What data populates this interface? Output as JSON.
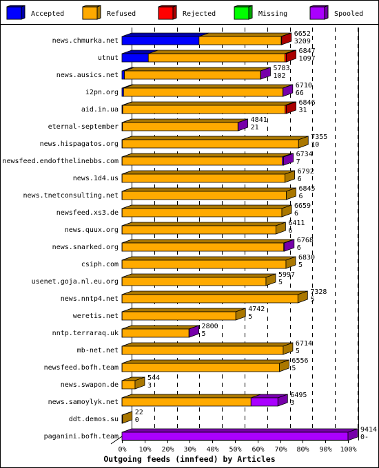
{
  "chart_data": {
    "type": "bar",
    "orientation": "horizontal",
    "stacked": true,
    "style": "3d",
    "xlabel": "Outgoing feeds (innfeed) by Articles",
    "xlim": [
      0,
      100
    ],
    "x_unit": "percent of maximum offered (9414)",
    "x_ticks": [
      "0%",
      "10%",
      "20%",
      "30%",
      "40%",
      "50%",
      "60%",
      "70%",
      "80%",
      "90%",
      "100%"
    ],
    "grid": true,
    "legend_position": "top",
    "legend": [
      {
        "name": "Accepted",
        "color": "#0000ff",
        "shade": "#0000aa"
      },
      {
        "name": "Refused",
        "color": "#ffaa00",
        "shade": "#aa7700"
      },
      {
        "name": "Rejected",
        "color": "#ff0000",
        "shade": "#aa0000"
      },
      {
        "name": "Missing",
        "color": "#00ff00",
        "shade": "#00aa00"
      },
      {
        "name": "Spooled",
        "color": "#aa00ff",
        "shade": "#7700aa"
      }
    ],
    "rows": [
      {
        "label": "news.chmurka.net",
        "offered": "6652",
        "accepted_label": "3209",
        "accepted": 3209,
        "rejected": 20,
        "missing": 0,
        "spooled": 0
      },
      {
        "label": "utnut",
        "offered": "6847",
        "accepted_label": "1097",
        "accepted": 1097,
        "rejected": 60,
        "missing": 0,
        "spooled": 0
      },
      {
        "label": "news.ausics.net",
        "offered": "5783",
        "accepted_label": "102",
        "accepted": 102,
        "rejected": 0,
        "missing": 0,
        "spooled": 10
      },
      {
        "label": "i2pn.org",
        "offered": "6710",
        "accepted_label": "66",
        "accepted": 66,
        "rejected": 0,
        "missing": 0,
        "spooled": 10
      },
      {
        "label": "aid.in.ua",
        "offered": "6846",
        "accepted_label": "31",
        "accepted": 31,
        "rejected": 50,
        "missing": 0,
        "spooled": 0
      },
      {
        "label": "eternal-september",
        "offered": "4841",
        "accepted_label": "21",
        "accepted": 21,
        "rejected": 0,
        "missing": 0,
        "spooled": 10
      },
      {
        "label": "news.hispagatos.org",
        "offered": "7355",
        "accepted_label": "10",
        "accepted": 10,
        "rejected": 0,
        "missing": 0,
        "spooled": 0
      },
      {
        "label": "newsfeed.endofthelinebbs.com",
        "offered": "6734",
        "accepted_label": "7",
        "accepted": 7,
        "rejected": 0,
        "missing": 0,
        "spooled": 60
      },
      {
        "label": "news.1d4.us",
        "offered": "6792",
        "accepted_label": "6",
        "accepted": 6,
        "rejected": 0,
        "missing": 0,
        "spooled": 0
      },
      {
        "label": "news.tnetconsulting.net",
        "offered": "6845",
        "accepted_label": "6",
        "accepted": 6,
        "rejected": 0,
        "missing": 0,
        "spooled": 0
      },
      {
        "label": "newsfeed.xs3.de",
        "offered": "6659",
        "accepted_label": "6",
        "accepted": 6,
        "rejected": 0,
        "missing": 0,
        "spooled": 0
      },
      {
        "label": "news.quux.org",
        "offered": "6411",
        "accepted_label": "6",
        "accepted": 6,
        "rejected": 0,
        "missing": 0,
        "spooled": 0
      },
      {
        "label": "news.snarked.org",
        "offered": "6768",
        "accepted_label": "6",
        "accepted": 6,
        "rejected": 0,
        "missing": 0,
        "spooled": 30
      },
      {
        "label": "csiph.com",
        "offered": "6830",
        "accepted_label": "5",
        "accepted": 5,
        "rejected": 0,
        "missing": 0,
        "spooled": 0
      },
      {
        "label": "usenet.goja.nl.eu.org",
        "offered": "5997",
        "accepted_label": "5",
        "accepted": 5,
        "rejected": 0,
        "missing": 0,
        "spooled": 0
      },
      {
        "label": "news.nntp4.net",
        "offered": "7328",
        "accepted_label": "5",
        "accepted": 5,
        "rejected": 0,
        "missing": 0,
        "spooled": 0
      },
      {
        "label": "weretis.net",
        "offered": "4742",
        "accepted_label": "5",
        "accepted": 5,
        "rejected": 0,
        "missing": 0,
        "spooled": 0
      },
      {
        "label": "nntp.terraraq.uk",
        "offered": "2800",
        "accepted_label": "5",
        "accepted": 5,
        "rejected": 0,
        "missing": 0,
        "spooled": 10
      },
      {
        "label": "mb-net.net",
        "offered": "6714",
        "accepted_label": "5",
        "accepted": 5,
        "rejected": 0,
        "missing": 0,
        "spooled": 0
      },
      {
        "label": "newsfeed.bofh.team",
        "offered": "6556",
        "accepted_label": "5",
        "accepted": 5,
        "rejected": 0,
        "missing": 0,
        "spooled": 0
      },
      {
        "label": "news.swapon.de",
        "offered": "544",
        "accepted_label": "3",
        "accepted": 3,
        "rejected": 0,
        "missing": 0,
        "spooled": 0
      },
      {
        "label": "news.samoylyk.net",
        "offered": "6495",
        "accepted_label": "3",
        "accepted": 3,
        "rejected": 0,
        "missing": 0,
        "spooled": 1120
      },
      {
        "label": "ddt.demos.su",
        "offered": "22",
        "accepted_label": "0",
        "accepted": 0,
        "rejected": 0,
        "missing": 0,
        "spooled": 0
      },
      {
        "label": "paganini.bofh.team",
        "offered": "9414",
        "accepted_label": "0-",
        "accepted": 0,
        "rejected": 0,
        "missing": 0,
        "spooled": 9414
      }
    ]
  }
}
